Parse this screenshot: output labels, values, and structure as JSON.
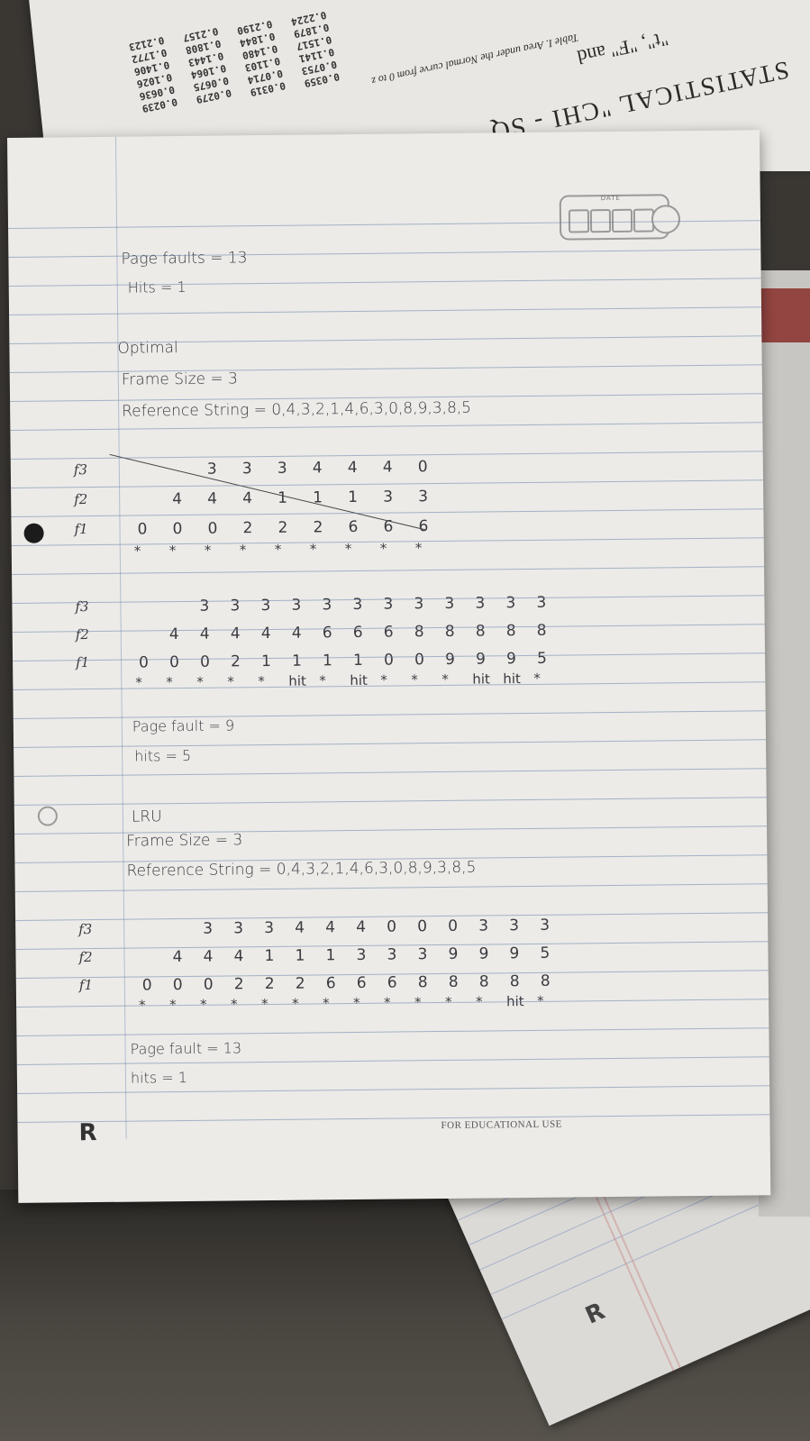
{
  "statistics_book": {
    "title": "STATISTICAL \"CHI - SQ",
    "subtitle": "\"t\", \"F\" and",
    "caption": "Table I. Area under the Normal curve from 0 to z",
    "columns": [
      [
        "0.0239",
        "0.0636",
        "0.1026",
        "0.1406",
        "0.1772",
        "0.2123"
      ],
      [
        "0.0279",
        "0.0675",
        "0.1064",
        "0.1443",
        "0.1808",
        "0.2157"
      ],
      [
        "0.0319",
        "0.0714",
        "0.1103",
        "0.1480",
        "0.1844",
        "0.2190"
      ],
      [
        "0.0359",
        "0.0753",
        "0.1141",
        "0.1517",
        "0.1879",
        "0.2224"
      ]
    ]
  },
  "notebook": {
    "date_label": "DATE",
    "footer": "FOR EDUCATIONAL USE",
    "fifo_summary": {
      "faults": "Page faults = 13",
      "hits": "Hits = 1"
    },
    "optimal": {
      "heading": "Optimal",
      "frame_size": "Frame Size = 3",
      "reference": "Reference String = 0,4,3,2,1,4,6,3,0,8,9,3,8,5",
      "attempt": {
        "f3": [
          "",
          "",
          "3",
          "3",
          "3",
          "4",
          "4",
          "4",
          "0"
        ],
        "f2": [
          "",
          "4",
          "4",
          "4",
          "1",
          "1",
          "1",
          "3",
          "3"
        ],
        "f1": [
          "0",
          "0",
          "0",
          "2",
          "2",
          "2",
          "6",
          "6",
          "6"
        ],
        "marks": [
          "*",
          "*",
          "*",
          "*",
          "*",
          "*",
          "*",
          "*",
          "*"
        ]
      },
      "table": {
        "f3": [
          "",
          "",
          "3",
          "3",
          "3",
          "3",
          "3",
          "3",
          "3",
          "3",
          "3",
          "3",
          "3",
          "3"
        ],
        "f2": [
          "",
          "4",
          "4",
          "4",
          "4",
          "4",
          "6",
          "6",
          "6",
          "8",
          "8",
          "8",
          "8",
          "8"
        ],
        "f1": [
          "0",
          "0",
          "0",
          "2",
          "1",
          "1",
          "1",
          "1",
          "0",
          "0",
          "9",
          "9",
          "9",
          "5"
        ],
        "marks": [
          "*",
          "*",
          "*",
          "*",
          "*",
          "hit",
          "*",
          "hit",
          "*",
          "*",
          "*",
          "hit",
          "hit",
          "*"
        ]
      },
      "faults": "Page fault = 9",
      "hits": "hits = 5"
    },
    "lru": {
      "heading": "LRU",
      "frame_size": "Frame Size = 3",
      "reference": "Reference String = 0,4,3,2,1,4,6,3,0,8,9,3,8,5",
      "table": {
        "f3": [
          "",
          "",
          "3",
          "3",
          "3",
          "4",
          "4",
          "4",
          "0",
          "0",
          "0",
          "3",
          "3",
          "3"
        ],
        "f2": [
          "",
          "4",
          "4",
          "4",
          "1",
          "1",
          "1",
          "3",
          "3",
          "3",
          "9",
          "9",
          "9",
          "5"
        ],
        "f1": [
          "0",
          "0",
          "0",
          "2",
          "2",
          "2",
          "6",
          "6",
          "6",
          "8",
          "8",
          "8",
          "8",
          "8"
        ],
        "marks": [
          "*",
          "*",
          "*",
          "*",
          "*",
          "*",
          "*",
          "*",
          "*",
          "*",
          "*",
          "*",
          "hit",
          "*"
        ]
      },
      "faults": "Page fault = 13",
      "hits": "hits = 1"
    },
    "row_labels": {
      "f3": "f3",
      "f2": "f2",
      "f1": "f1"
    }
  }
}
